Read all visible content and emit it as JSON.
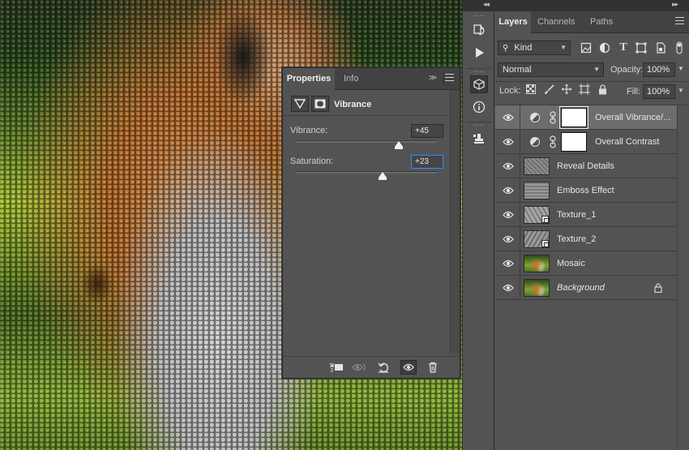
{
  "app": {
    "accent_selected": "#6d6d6d",
    "focus_border": "#4b86c6"
  },
  "toolstrip": {
    "items": [
      {
        "icon": "history-icon"
      },
      {
        "icon": "play-action-icon"
      },
      {
        "icon": "3d-cube-icon"
      },
      {
        "icon": "info-icon"
      },
      {
        "icon": "clone-source-icon"
      }
    ]
  },
  "layers_panel": {
    "tabs": [
      "Layers",
      "Channels",
      "Paths"
    ],
    "filter_kind": "Kind",
    "blend_mode": "Normal",
    "opacity_label": "Opacity:",
    "opacity_value": "100%",
    "lock_label": "Lock:",
    "fill_label": "Fill:",
    "fill_value": "100%",
    "layers": [
      {
        "name": "Overall Vibrance/...",
        "type": "adjustment",
        "selected": true
      },
      {
        "name": "Overall Contrast",
        "type": "adjustment"
      },
      {
        "name": "Reveal Details",
        "type": "pixel"
      },
      {
        "name": "Emboss Effect",
        "type": "pixel"
      },
      {
        "name": "Texture_1",
        "type": "smart-object"
      },
      {
        "name": "Texture_2",
        "type": "smart-object"
      },
      {
        "name": "Mosaic",
        "type": "pixel"
      },
      {
        "name": "Background",
        "type": "background",
        "italic": true,
        "locked": true
      }
    ]
  },
  "properties_panel": {
    "tabs": [
      "Properties",
      "Info"
    ],
    "title": "Vibrance",
    "sliders": [
      {
        "label": "Vibrance:",
        "value": "+45",
        "percent": 72.5
      },
      {
        "label": "Saturation:",
        "value": "+23",
        "percent": 61.5,
        "focused": true
      }
    ],
    "footer_buttons": [
      "clip-to-layer-icon",
      "view-previous-icon",
      "reset-icon",
      "visibility-eye-icon",
      "trash-icon"
    ]
  }
}
